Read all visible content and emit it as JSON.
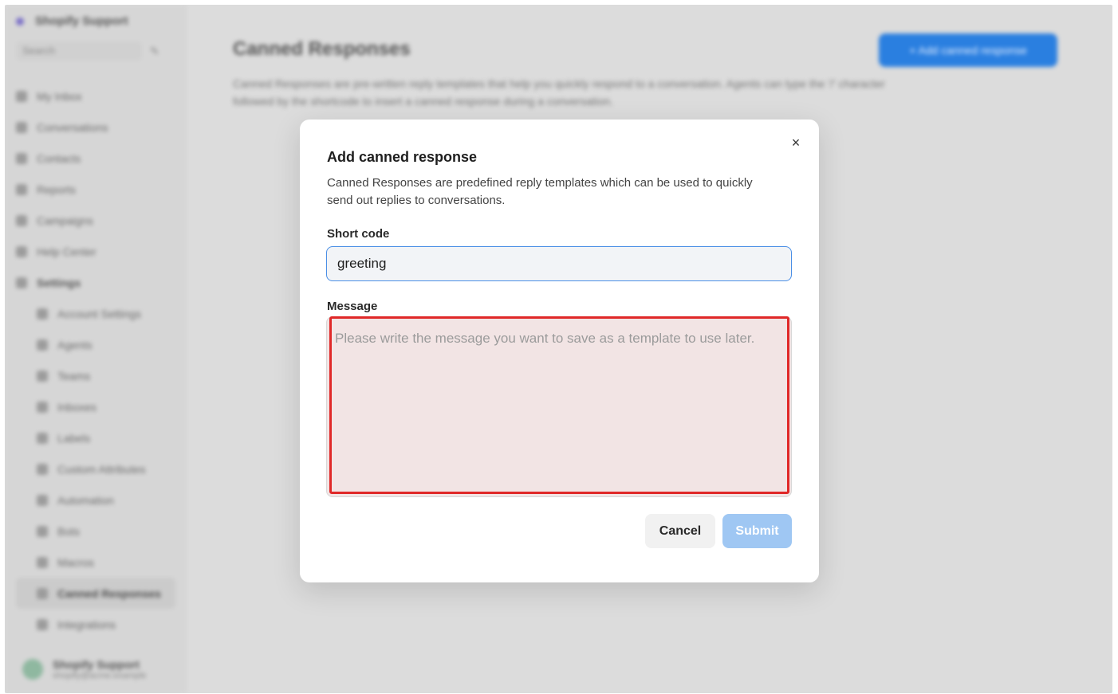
{
  "app": {
    "workspace_name": "Shopify Support",
    "search_placeholder": "Search",
    "nav": [
      {
        "label": "My Inbox",
        "icon": "inbox-icon"
      },
      {
        "label": "Conversations",
        "icon": "chat-icon"
      },
      {
        "label": "Contacts",
        "icon": "contacts-icon"
      },
      {
        "label": "Reports",
        "icon": "reports-icon"
      },
      {
        "label": "Campaigns",
        "icon": "megaphone-icon"
      },
      {
        "label": "Help Center",
        "icon": "book-icon"
      },
      {
        "label": "Settings",
        "icon": "gear-icon"
      }
    ],
    "settings_nav": [
      {
        "label": "Account Settings",
        "icon": "gear-icon"
      },
      {
        "label": "Agents",
        "icon": "agent-icon"
      },
      {
        "label": "Teams",
        "icon": "teams-icon"
      },
      {
        "label": "Inboxes",
        "icon": "inbox-icon"
      },
      {
        "label": "Labels",
        "icon": "tag-icon"
      },
      {
        "label": "Custom Attributes",
        "icon": "code-icon"
      },
      {
        "label": "Automation",
        "icon": "automation-icon"
      },
      {
        "label": "Bots",
        "icon": "bot-icon"
      },
      {
        "label": "Macros",
        "icon": "macro-icon"
      },
      {
        "label": "Canned Responses",
        "icon": "canned-icon"
      },
      {
        "label": "Integrations",
        "icon": "plug-icon"
      }
    ],
    "footer_name": "Shopify Support",
    "footer_sub": "shopify@acme.example",
    "page_title": "Canned Responses",
    "page_description": "Canned Responses are pre-written reply templates that help you quickly respond to a conversation. Agents can type the '/' character followed by the shortcode to insert a canned response during a conversation.",
    "add_button_label": "+ Add canned response"
  },
  "modal": {
    "close_icon": "×",
    "title": "Add canned response",
    "description": "Canned Responses are predefined reply templates which can be used to quickly send out replies to conversations.",
    "short_code_label": "Short code",
    "short_code_value": "greeting",
    "message_label": "Message",
    "message_placeholder": "Please write the message you want to save as a template to use later.",
    "cancel_label": "Cancel",
    "submit_label": "Submit",
    "highlight_color": "#e02828"
  }
}
